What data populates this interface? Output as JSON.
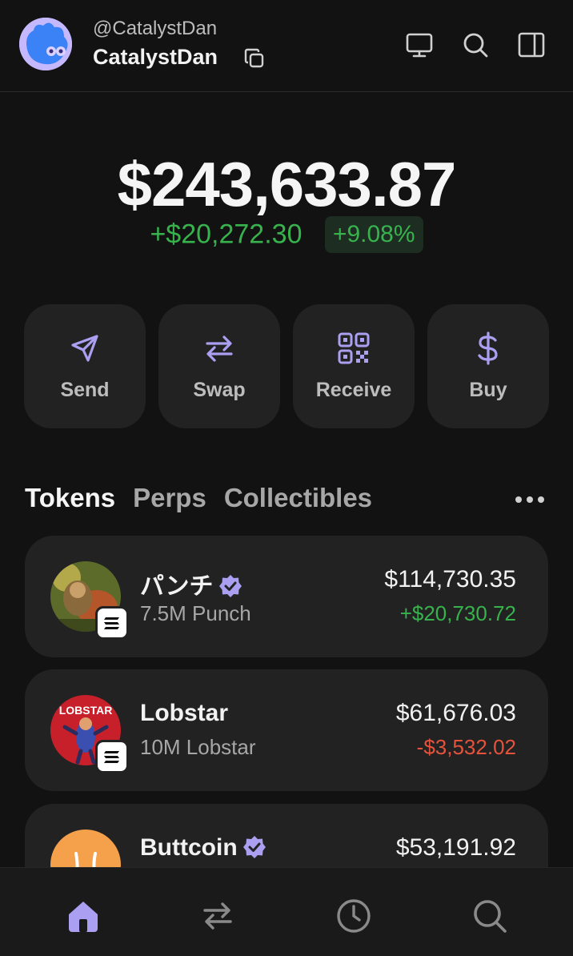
{
  "header": {
    "handle": "@CatalystDan",
    "username": "CatalystDan"
  },
  "balance": {
    "total": "$243,633.87",
    "change_abs": "+$20,272.30",
    "change_pct": "+9.08%"
  },
  "actions": [
    {
      "label": "Send",
      "icon": "send-icon"
    },
    {
      "label": "Swap",
      "icon": "swap-icon"
    },
    {
      "label": "Receive",
      "icon": "qr-code-icon"
    },
    {
      "label": "Buy",
      "icon": "dollar-icon"
    }
  ],
  "tabs": [
    {
      "label": "Tokens",
      "active": true
    },
    {
      "label": "Perps",
      "active": false
    },
    {
      "label": "Collectibles",
      "active": false
    }
  ],
  "tokens": [
    {
      "name": "パンチ",
      "verified": true,
      "amount": "7.5M Punch",
      "value": "$114,730.35",
      "change": "+$20,730.72",
      "change_color": "#37b24d"
    },
    {
      "name": "Lobstar",
      "verified": false,
      "amount": "10M Lobstar",
      "value": "$61,676.03",
      "change": "-$3,532.02",
      "change_color": "#e5533d",
      "logo_text": "LOBSTAR"
    },
    {
      "name": "Buttcoin",
      "verified": true,
      "amount": "",
      "value": "$53,191.92",
      "change": ""
    }
  ],
  "colors": {
    "accent": "#ab9ff2",
    "positive": "#37b24d",
    "negative": "#e5533d",
    "background": "#121212",
    "card": "#222222"
  },
  "bottom_nav": [
    "home-icon",
    "swap-icon",
    "history-icon",
    "search-icon"
  ]
}
